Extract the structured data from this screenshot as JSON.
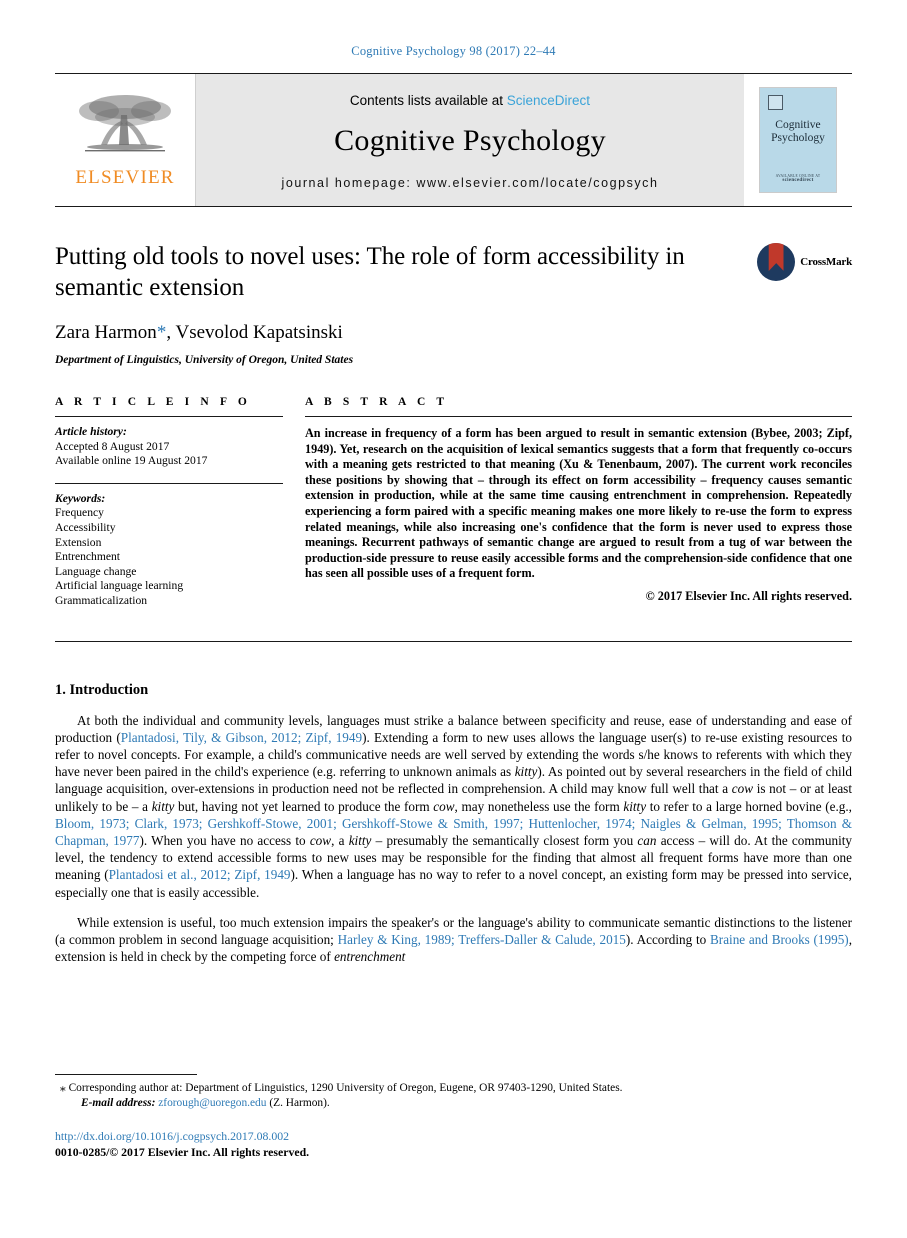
{
  "running_head": "Cognitive Psychology 98 (2017) 22–44",
  "masthead": {
    "contents_prefix": "Contents lists available at",
    "sciencedirect": "ScienceDirect",
    "journal_name": "Cognitive Psychology",
    "homepage": "journal homepage: www.elsevier.com/locate/cogpsych",
    "publisher_name": "ELSEVIER",
    "cover_title_line1": "Cognitive",
    "cover_title_line2": "Psychology",
    "cover_foot_small": "AVAILABLE ONLINE AT",
    "cover_foot_brand": "sciencedirect",
    "accent_link_color": "#3aa3d8",
    "publisher_color": "#f08c24",
    "cover_color": "#b9d9e8"
  },
  "article": {
    "title": "Putting old tools to novel uses: The role of form accessibility in semantic extension",
    "authors": "Zara Harmon, Vsevolod Kapatsinski",
    "author_first": "Zara Harmon",
    "author_sep": ", ",
    "author_second": "Vsevolod Kapatsinski",
    "corresponding_star": "*",
    "affiliation": "Department of Linguistics, University of Oregon, United States",
    "crossmark_label": "CrossMark"
  },
  "info": {
    "heading": "A R T I C L E   I N F O",
    "history_label": "Article history:",
    "history": [
      "Accepted 8 August 2017",
      "Available online 19 August 2017"
    ],
    "keywords_label": "Keywords:",
    "keywords": [
      "Frequency",
      "Accessibility",
      "Extension",
      "Entrenchment",
      "Language change",
      "Artificial language learning",
      "Grammaticalization"
    ]
  },
  "abstract": {
    "heading": "A B S T R A C T",
    "text": "An increase in frequency of a form has been argued to result in semantic extension (Bybee, 2003; Zipf, 1949). Yet, research on the acquisition of lexical semantics suggests that a form that frequently co-occurs with a meaning gets restricted to that meaning (Xu & Tenenbaum, 2007). The current work reconciles these positions by showing that – through its effect on form accessibility – frequency causes semantic extension in production, while at the same time causing entrenchment in comprehension. Repeatedly experiencing a form paired with a specific meaning makes one more likely to re-use the form to express related meanings, while also increasing one's confidence that the form is never used to express those meanings. Recurrent pathways of semantic change are argued to result from a tug of war between the production-side pressure to reuse easily accessible forms and the comprehension-side confidence that one has seen all possible uses of a frequent form.",
    "copyright": "© 2017 Elsevier Inc. All rights reserved."
  },
  "body": {
    "section_number_title": "1. Introduction",
    "paragraph1": {
      "part1": "At both the individual and community levels, languages must strike a balance between specificity and reuse, ease of understanding and ease of production (",
      "cite1": "Plantadosi, Tily, & Gibson, 2012; Zipf, 1949",
      "part2": "). Extending a form to new uses allows the language user(s) to re-use existing resources to refer to novel concepts. For example, a child's communicative needs are well served by extending the words s/he knows to referents with which they have never been paired in the child's experience (e.g. referring to unknown animals as ",
      "italic1": "kitty",
      "part3": "). As pointed out by several researchers in the field of child language acquisition, over-extensions in production need not be reflected in comprehension. A child may know full well that a ",
      "italic2": "cow",
      "part4": " is not – or at least unlikely to be – a ",
      "italic3": "kitty",
      "part5": " but, having not yet learned to produce the form ",
      "italic4": "cow",
      "part6": ", may nonetheless use the form ",
      "italic5": "kitty",
      "part7": " to refer to a large horned bovine (e.g., ",
      "cite2": "Bloom, 1973; Clark, 1973; Gershkoff-Stowe, 2001; Gershkoff-Stowe & Smith, 1997; Huttenlocher, 1974; Naigles & Gelman, 1995; Thomson & Chapman, 1977",
      "part8": "). When you have no access to ",
      "italic6": "cow",
      "part9": ", a ",
      "italic7": "kitty",
      "part10": " – presumably the semantically closest form you ",
      "italic8": "can",
      "part11": " access – will do. At the community level, the tendency to extend accessible forms to new uses may be responsible for the finding that almost all frequent forms have more than one meaning (",
      "cite3": "Plantadosi et al., 2012; Zipf, 1949",
      "part12": "). When a language has no way to refer to a novel concept, an existing form may be pressed into service, especially one that is easily accessible."
    },
    "paragraph2": {
      "part1": "While extension is useful, too much extension impairs the speaker's or the language's ability to communicate semantic distinctions to the listener (a common problem in second language acquisition; ",
      "cite1": "Harley & King, 1989; Treffers-Daller & Calude, 2015",
      "part2": "). According to ",
      "cite2": "Braine and Brooks (1995)",
      "part3": ", extension is held in check by the competing force of ",
      "italic1": "entrenchment"
    }
  },
  "footer": {
    "corresponding_marker": "⁎",
    "corresponding_text": "Corresponding author at: Department of Linguistics, 1290 University of Oregon, Eugene, OR 97403-1290, United States.",
    "email_label": "E-mail address:",
    "email": "zforough@uoregon.edu",
    "email_suffix": "(Z. Harmon).",
    "doi": "http://dx.doi.org/10.1016/j.cogpsych.2017.08.002",
    "issn_line": "0010-0285/© 2017 Elsevier Inc. All rights reserved."
  }
}
